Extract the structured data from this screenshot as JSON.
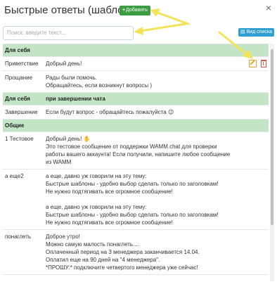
{
  "header": {
    "title": "Быстрые ответы (шаблоны)",
    "add_button": "Добавить",
    "close": "×"
  },
  "search": {
    "placeholder": "Поиск: введите текст..."
  },
  "view_list_button": "Вид списка",
  "groups": [
    {
      "name": "Для себя",
      "subtitle": "",
      "rows": [
        {
          "name": "Приветствие",
          "lines": [
            "Добрый день!"
          ],
          "has_actions": true
        },
        {
          "name": "Прощание",
          "lines": [
            "Рады были помочь.",
            "Обращайтесь, если возникнут вопросы )"
          ]
        }
      ]
    },
    {
      "name": "Для себя",
      "subtitle": "при завершении чата",
      "rows": [
        {
          "name": "Завершение",
          "lines": [
            "Если будут вопрос - обращайтесь пожалуйста 😉"
          ]
        }
      ]
    },
    {
      "name": "Общие",
      "subtitle": "",
      "rows": [
        {
          "name": "1 Тестовое",
          "lines": [
            "Добрый день! ✋",
            "Это тестовое сообщение от поддержки WAMM.chat для проверки работы вашего аккаунта! Если получили, напишите любое сообщение из WAMM"
          ]
        },
        {
          "name": "а еще2",
          "lines": [
            "а еще, давно уж говорили на эту тему:",
            "Быстрые шаблоны - удобно выбор сделать только по заголовкам!",
            "Не нужно подтягивать все огромное сообщение!",
            "",
            "а еще, давно уж говорили на эту тему:",
            "Быстрые шаблоны - удобно выбор сделать только по заголовкам!",
            "Не нужно подтягивать все огромное сообщение!"
          ]
        },
        {
          "name": "понаглеть",
          "lines": [
            "Доброе утро!",
            "Можно самую малость понаглеть....",
            "Оплаченный период на 3 менеджера заканчивается 14.04.",
            "Оплатил еще на 90 дней на \"4 менеджера\".",
            "*ПРОШУ:* подключите четвертого менеджера уже сейчас!"
          ]
        }
      ]
    }
  ],
  "icons": {
    "add": "plus-icon",
    "edit": "edit-icon",
    "delete": "trash-icon",
    "close": "close-icon"
  },
  "colors": {
    "group_header_bg": "#c3e5c6",
    "add_button": "#3c9c41",
    "view_button": "#2e9fd0",
    "arrow_annotation": "#f2e35a"
  }
}
